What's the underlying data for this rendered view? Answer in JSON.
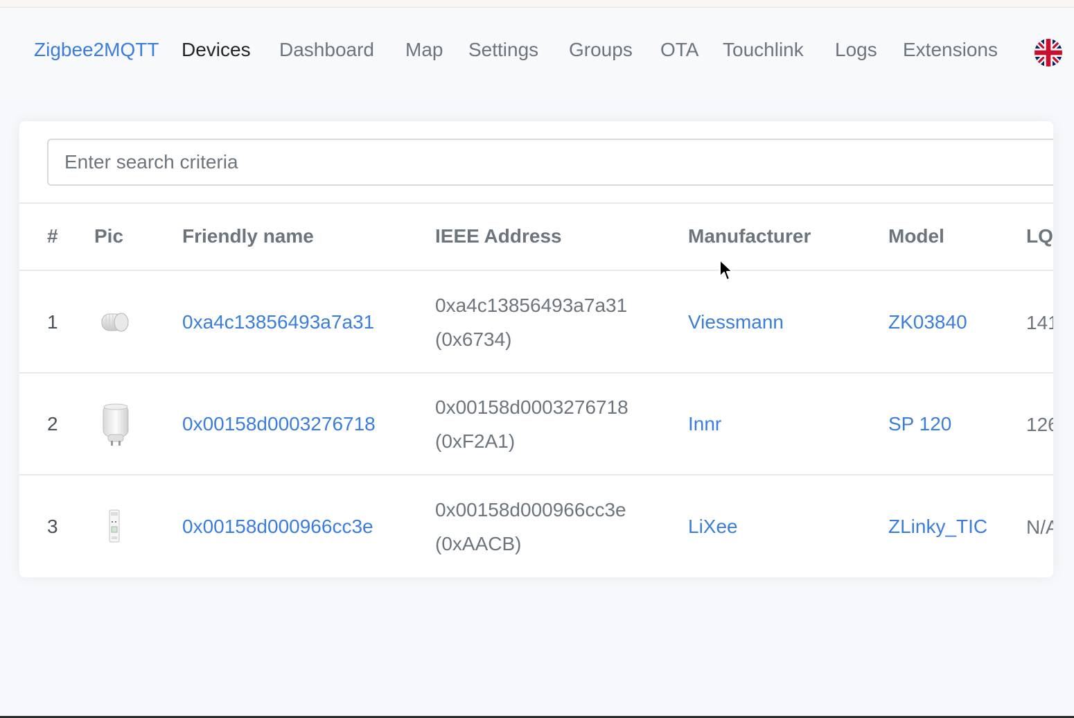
{
  "nav": {
    "brand": "Zigbee2MQTT",
    "links": [
      "Devices",
      "Dashboard",
      "Map",
      "Settings",
      "Groups",
      "OTA",
      "Touchlink",
      "Logs",
      "Extensions"
    ],
    "active": "Devices",
    "language_icon": "uk-flag-icon"
  },
  "search": {
    "placeholder": "Enter search criteria",
    "value": ""
  },
  "table": {
    "columns": [
      "#",
      "Pic",
      "Friendly name",
      "IEEE Address",
      "Manufacturer",
      "Model",
      "LQ"
    ],
    "rows": [
      {
        "index": "1",
        "pic": "thermostat-valve-icon",
        "friendly_name": "0xa4c13856493a7a31",
        "ieee": "0xa4c13856493a7a31",
        "network": "(0x6734)",
        "manufacturer": "Viessmann",
        "model": "ZK03840",
        "lqi": "141"
      },
      {
        "index": "2",
        "pic": "smart-plug-icon",
        "friendly_name": "0x00158d0003276718",
        "ieee": "0x00158d0003276718",
        "network": "(0xF2A1)",
        "manufacturer": "Innr",
        "model": "SP 120",
        "lqi": "126"
      },
      {
        "index": "3",
        "pic": "din-module-icon",
        "friendly_name": "0x00158d000966cc3e",
        "ieee": "0x00158d000966cc3e",
        "network": "(0xAACB)",
        "manufacturer": "LiXee",
        "model": "ZLinky_TIC",
        "lqi": "N/A"
      }
    ]
  },
  "colors": {
    "link": "#3b7ddd",
    "text_muted": "#6c757d",
    "background": "#f6f8fb",
    "card": "#ffffff"
  }
}
